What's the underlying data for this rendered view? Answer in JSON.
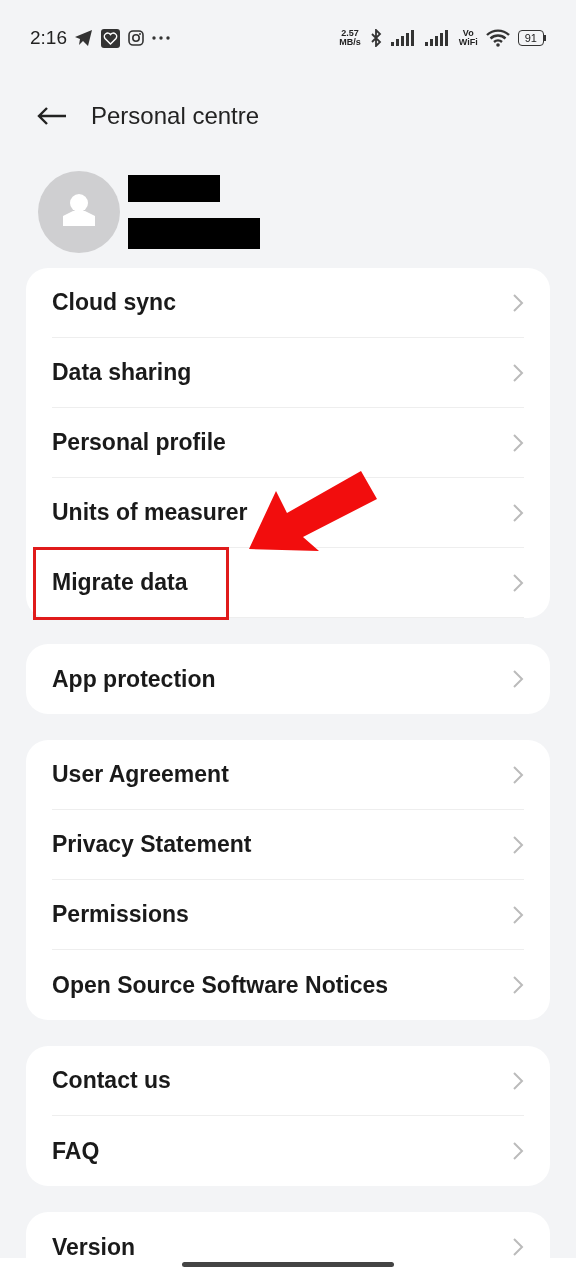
{
  "status_bar": {
    "time": "2:16",
    "net_speed": "2.57",
    "net_unit": "MB/s",
    "vowifi_top": "Vo",
    "vowifi_bottom": "WiFi",
    "battery": "91"
  },
  "header": {
    "title": "Personal centre"
  },
  "groups": [
    {
      "items": [
        {
          "label": "Cloud sync",
          "highlighted": false
        },
        {
          "label": "Data sharing",
          "highlighted": false
        },
        {
          "label": "Personal profile",
          "highlighted": false
        },
        {
          "label": "Units of measurer",
          "highlighted": false
        },
        {
          "label": "Migrate data",
          "highlighted": true
        }
      ]
    },
    {
      "items": [
        {
          "label": "App protection",
          "highlighted": false
        }
      ]
    },
    {
      "items": [
        {
          "label": "User Agreement",
          "highlighted": false
        },
        {
          "label": "Privacy Statement",
          "highlighted": false
        },
        {
          "label": "Permissions",
          "highlighted": false
        },
        {
          "label": "Open Source Software Notices",
          "highlighted": false
        }
      ]
    },
    {
      "items": [
        {
          "label": "Contact us",
          "highlighted": false
        },
        {
          "label": "FAQ",
          "highlighted": false
        }
      ]
    },
    {
      "items": [
        {
          "label": "Version",
          "highlighted": false
        }
      ]
    }
  ]
}
